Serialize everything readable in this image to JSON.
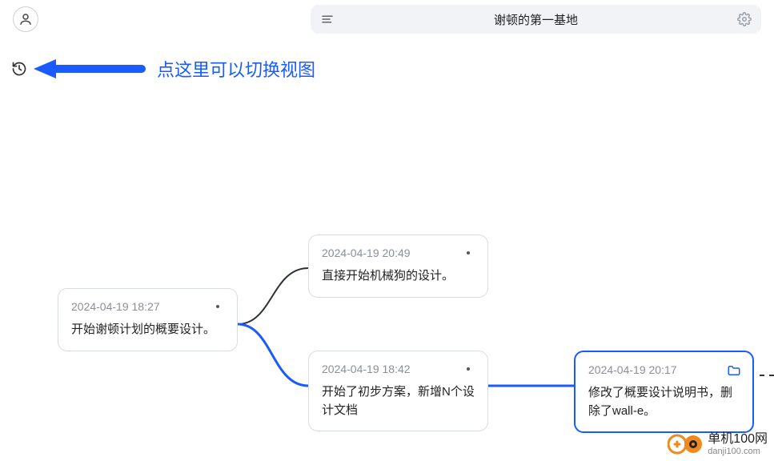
{
  "header": {
    "title": "谢顿的第一基地"
  },
  "hint": {
    "text": "点这里可以切换视图"
  },
  "nodes": {
    "root": {
      "timestamp": "2024-04-19 18:27",
      "content": "开始谢顿计划的概要设计。"
    },
    "top": {
      "timestamp": "2024-04-19 20:49",
      "content": "直接开始机械狗的设计。"
    },
    "bottom": {
      "timestamp": "2024-04-19 18:42",
      "content": "开始了初步方案，新增N个设计文档"
    },
    "selected": {
      "timestamp": "2024-04-19 20:17",
      "content": "修改了概要设计说明书，删除了wall-e。"
    }
  },
  "watermark": {
    "main": "单机100网",
    "sub": "danji100.com"
  }
}
